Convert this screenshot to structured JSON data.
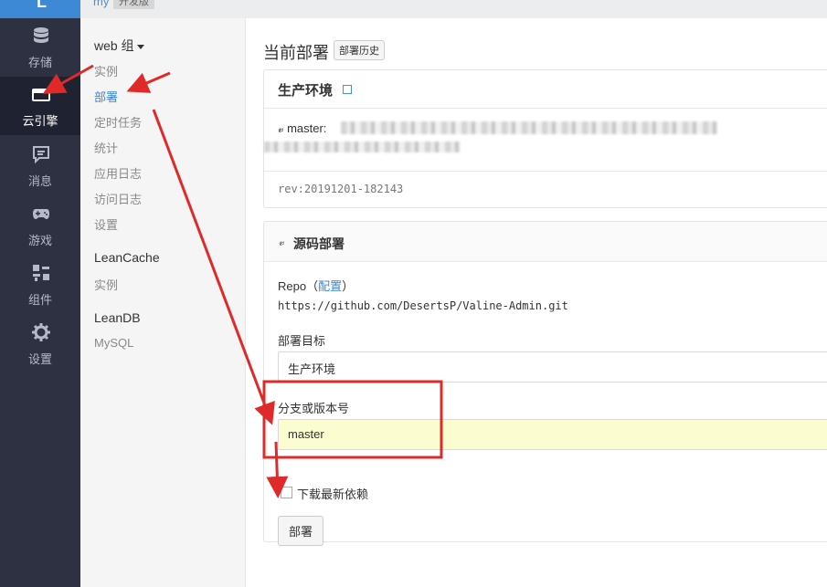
{
  "topbar": {
    "logo_letter": "L",
    "app_name": "my",
    "env_badge": "开发版"
  },
  "nav": [
    {
      "id": "storage",
      "label": "存储",
      "icon": "database-icon"
    },
    {
      "id": "engine",
      "label": "云引擎",
      "icon": "cloud-engine-icon",
      "active": true
    },
    {
      "id": "message",
      "label": "消息",
      "icon": "message-icon"
    },
    {
      "id": "game",
      "label": "游戏",
      "icon": "gamepad-icon"
    },
    {
      "id": "component",
      "label": "组件",
      "icon": "component-icon"
    },
    {
      "id": "settings",
      "label": "设置",
      "icon": "gear-icon"
    }
  ],
  "submenu": {
    "group_web": "web 组",
    "web_items": [
      "实例",
      "部署",
      "定时任务",
      "统计",
      "应用日志",
      "访问日志",
      "设置"
    ],
    "active_item": "部署",
    "group_leancache": "LeanCache",
    "leancache_items": [
      "实例"
    ],
    "group_leandb": "LeanDB",
    "leandb_items": [
      "MySQL"
    ]
  },
  "main": {
    "title": "当前部署",
    "history_button": "部署历史",
    "current": {
      "env_title": "生产环境",
      "branch_label": "master:",
      "rev": "rev:20191201-182143"
    },
    "source": {
      "title": "源码部署",
      "repo_label": "Repo（",
      "repo_link": "配置",
      "repo_label_close": "）",
      "repo_url": "https://github.com/DesertsP/Valine-Admin.git",
      "target_label": "部署目标",
      "target_value": "生产环境",
      "branch_label": "分支或版本号",
      "branch_value": "master",
      "download_deps_label": "下载最新依赖",
      "download_deps_checked": false,
      "deploy_button": "部署"
    }
  },
  "colors": {
    "nav_bg": "#2e3142",
    "accent": "#3a86d6",
    "annotation": "#e02a2a",
    "highlight_field": "#fbfdd0"
  }
}
